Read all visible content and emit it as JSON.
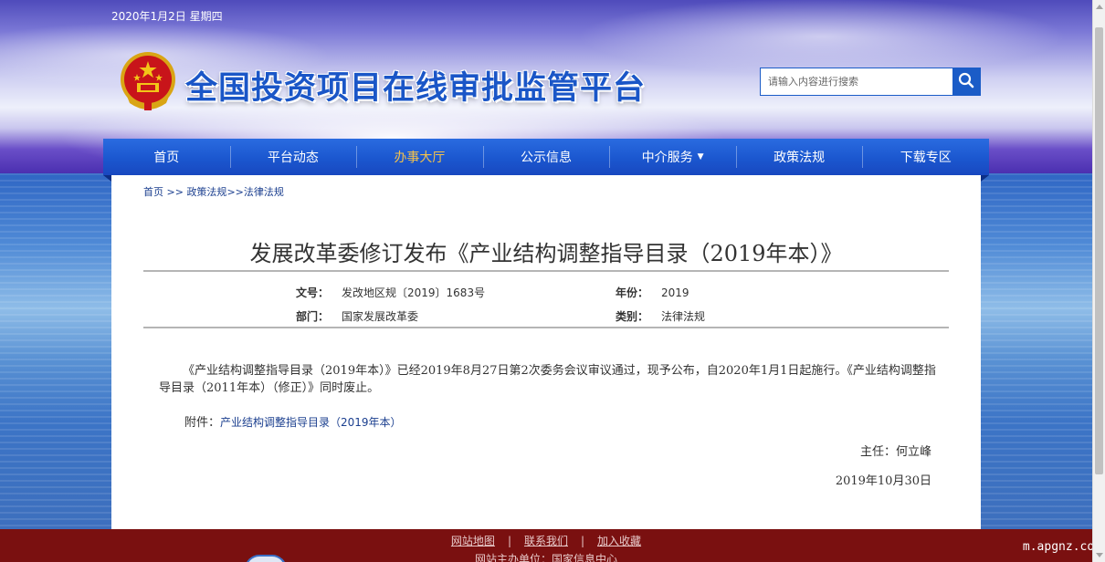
{
  "header": {
    "date": "2020年1月2日 星期四",
    "site_title": "全国投资项目在线审批监管平台",
    "search_placeholder": "请输入内容进行搜索"
  },
  "nav": {
    "items": [
      "首页",
      "平台动态",
      "办事大厅",
      "公示信息",
      "中介服务",
      "政策法规",
      "下载专区"
    ],
    "active": "办事大厅",
    "dropdown_item": "中介服务"
  },
  "breadcrumb": {
    "home": "首页",
    "sep1": " >> ",
    "policy": "政策法规",
    "sep2": ">>",
    "current": "法律法规"
  },
  "article": {
    "title": "发展改革委修订发布《产业结构调整指导目录（2019年本）》",
    "meta": {
      "doc_no_label": "文号：",
      "doc_no": "发改地区规〔2019〕1683号",
      "year_label": "年份：",
      "year": "2019",
      "dept_label": "部门：",
      "dept": "国家发展改革委",
      "category_label": "类别：",
      "category": "法律法规"
    },
    "body": "《产业结构调整指导目录（2019年本）》已经2019年8月27日第2次委务会议审议通过，现予公布，自2020年1月1日起施行。《产业结构调整指导目录（2011年本）（修正）》同时废止。",
    "attachment_label": "附件：",
    "attachment_link": "产业结构调整指导目录（2019年本）",
    "signer": "主任：何立峰",
    "date": "2019年10月30日"
  },
  "footer": {
    "links": [
      "网站地图",
      "联系我们",
      "加入收藏"
    ],
    "separator": "|",
    "org": "网站主办单位：国家信息中心"
  },
  "watermark": "m.apgnz.com",
  "colors": {
    "nav_blue": "#1b57cf",
    "nav_active": "#f4c24c",
    "title_blue": "#1a56c7",
    "footer_red": "#7a1010",
    "link_blue": "#1b3f8f"
  },
  "icons": {
    "emblem": "national-emblem-icon",
    "search": "search-icon",
    "caret": "caret-down-icon"
  }
}
